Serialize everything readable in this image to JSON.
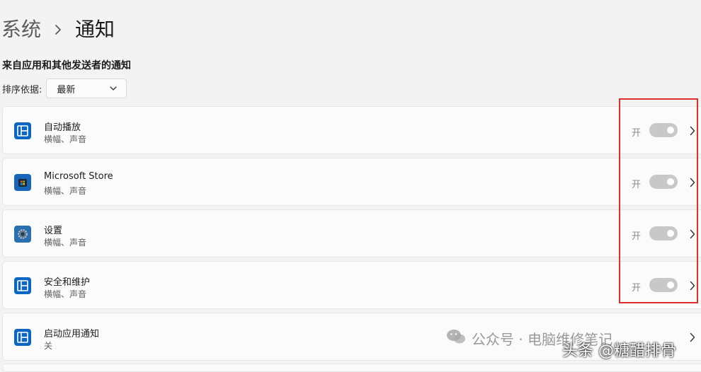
{
  "breadcrumb": {
    "parent": "系统",
    "separator_icon": "chevron-right-icon",
    "current": "通知"
  },
  "section": {
    "title": "来自应用和其他发送者的通知"
  },
  "sort": {
    "label": "排序依据:",
    "value": "最新"
  },
  "apps": [
    {
      "name": "自动播放",
      "subtitle": "横幅、声音",
      "state": "开",
      "icon": "autoplay-icon",
      "enabled": true
    },
    {
      "name": "Microsoft Store",
      "subtitle": "横幅、声音",
      "state": "开",
      "icon": "microsoft-store-icon",
      "enabled": true
    },
    {
      "name": "设置",
      "subtitle": "横幅、声音",
      "state": "开",
      "icon": "settings-gear-icon",
      "enabled": true
    },
    {
      "name": "安全和维护",
      "subtitle": "横幅、声音",
      "state": "开",
      "icon": "security-maintenance-icon",
      "enabled": true
    },
    {
      "name": "启动应用通知",
      "subtitle": "关",
      "state": "",
      "icon": "startup-app-icon",
      "enabled": false
    }
  ],
  "watermarks": {
    "wechat": "公众号 · 电脑维修笔记",
    "toutiao": "头条 @糖醋排骨"
  },
  "colors": {
    "accent_blue": "#0078d4",
    "toggle_gray": "#c8c8c8",
    "highlight_red": "#d9302b",
    "background": "#f3f3f3"
  }
}
